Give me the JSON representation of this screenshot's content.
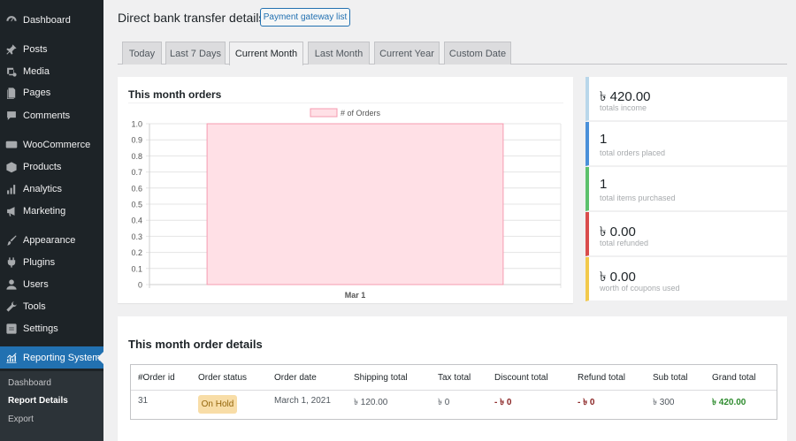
{
  "sidebar": {
    "items": [
      {
        "label": "Dashboard",
        "icon": "dashboard-icon"
      },
      {
        "label": "Posts",
        "icon": "pushpin-icon"
      },
      {
        "label": "Media",
        "icon": "media-icon"
      },
      {
        "label": "Pages",
        "icon": "pages-icon"
      },
      {
        "label": "Comments",
        "icon": "comment-icon"
      },
      {
        "label": "WooCommerce",
        "icon": "woocommerce-icon"
      },
      {
        "label": "Products",
        "icon": "box-icon"
      },
      {
        "label": "Analytics",
        "icon": "bar-chart-icon"
      },
      {
        "label": "Marketing",
        "icon": "megaphone-icon"
      },
      {
        "label": "Appearance",
        "icon": "paintbrush-icon"
      },
      {
        "label": "Plugins",
        "icon": "plug-icon"
      },
      {
        "label": "Users",
        "icon": "user-icon"
      },
      {
        "label": "Tools",
        "icon": "wrench-icon"
      },
      {
        "label": "Settings",
        "icon": "settings-icon"
      },
      {
        "label": "Reporting System",
        "icon": "reporting-icon"
      }
    ],
    "submenu": [
      {
        "label": "Dashboard"
      },
      {
        "label": "Report Details"
      },
      {
        "label": "Export"
      }
    ]
  },
  "header": {
    "title": "Direct bank transfer details",
    "gateway_button": "Payment gateway list"
  },
  "tabs": [
    {
      "label": "Today"
    },
    {
      "label": "Last 7 Days"
    },
    {
      "label": "Current Month"
    },
    {
      "label": "Last Month"
    },
    {
      "label": "Current Year"
    },
    {
      "label": "Custom Date"
    }
  ],
  "active_tab": "Current Month",
  "chart_card": {
    "title": "This month orders"
  },
  "chart_data": {
    "type": "bar",
    "categories": [
      "Mar 1"
    ],
    "series": [
      {
        "name": "# of Orders",
        "values": [
          1
        ]
      }
    ],
    "ylim": [
      0,
      1.0
    ],
    "yticks": [
      "1.0",
      "0.9",
      "0.8",
      "0.7",
      "0.6",
      "0.5",
      "0.4",
      "0.3",
      "0.2",
      "0.1",
      "0"
    ],
    "grid": true,
    "legend": "top-center",
    "colors": {
      "bar_fill": "#ffe0e6",
      "bar_stroke": "#f59bb0"
    }
  },
  "stats": [
    {
      "value": "৳ 420.00",
      "label": "totals income",
      "color": "#b9d7ea"
    },
    {
      "value": "1",
      "label": "total orders placed",
      "color": "#4a90d9"
    },
    {
      "value": "1",
      "label": "total items purchased",
      "color": "#5cc16c"
    },
    {
      "value": "৳ 0.00",
      "label": "total refunded",
      "color": "#d94c4c"
    },
    {
      "value": "৳ 0.00",
      "label": "worth of coupons used",
      "color": "#f2c94c"
    }
  ],
  "details": {
    "title": "This month order details",
    "columns": [
      "#Order id",
      "Order status",
      "Order date",
      "Shipping total",
      "Tax total",
      "Discount total",
      "Refund total",
      "Sub total",
      "Grand total"
    ],
    "rows": [
      {
        "order_id": "31",
        "status": "On Hold",
        "date": "March 1, 2021",
        "shipping": "৳ 120.00",
        "tax": "৳ 0",
        "discount_sign": "- ৳",
        "discount_value": "0",
        "refund_sign": "- ৳",
        "refund_value": "0",
        "subtotal": "৳ 300",
        "grand_sign": "৳",
        "grand_value": "420.00"
      }
    ]
  }
}
